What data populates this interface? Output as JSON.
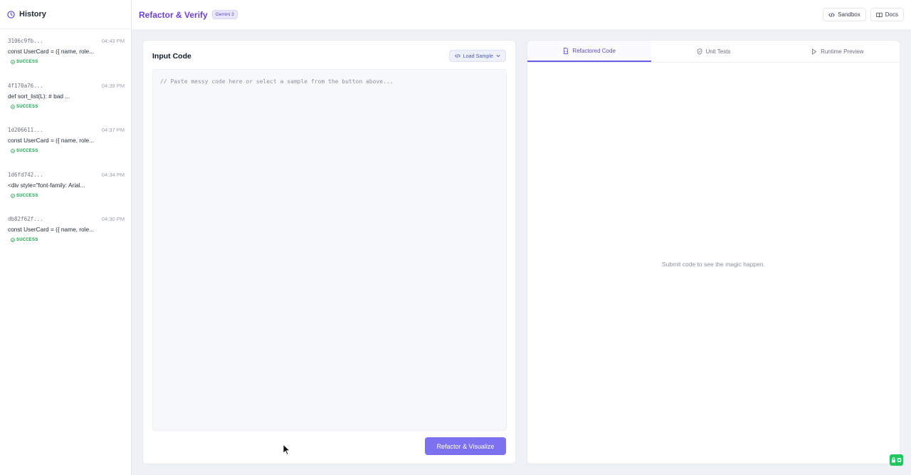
{
  "sidebar": {
    "title": "History",
    "items": [
      {
        "hash": "3106c9fb...",
        "time": "04:43 PM",
        "preview": "const UserCard = ({ name, role...",
        "status": "SUCCESS"
      },
      {
        "hash": "4f170a76...",
        "time": "04:39 PM",
        "preview": "def sort_list(L): # bad ...",
        "status": "SUCCESS"
      },
      {
        "hash": "1d206611...",
        "time": "04:37 PM",
        "preview": "const UserCard = ({ name, role...",
        "status": "SUCCESS"
      },
      {
        "hash": "1d6fd742...",
        "time": "04:34 PM",
        "preview": "<div style=\"font-family: Arial...",
        "status": "SUCCESS"
      },
      {
        "hash": "db82f62f...",
        "time": "04:30 PM",
        "preview": "const UserCard = ({ name, role...",
        "status": "SUCCESS"
      }
    ]
  },
  "header": {
    "title": "Refactor & Verify",
    "badge": "Gemini 3",
    "sandbox_label": "Sandbox",
    "docs_label": "Docs"
  },
  "input": {
    "title": "Input Code",
    "load_sample_label": "Load Sample",
    "value": "",
    "placeholder": "// Paste messy code here or select a sample from the button above...",
    "submit_label": "Refactor & Visualize"
  },
  "output": {
    "tabs": [
      {
        "label": "Refactored Code",
        "icon": "file-code-icon",
        "active": true
      },
      {
        "label": "Unit Tests",
        "icon": "shield-check-icon",
        "active": false
      },
      {
        "label": "Runtime Preview",
        "icon": "play-icon",
        "active": false
      }
    ],
    "empty_message": "Submit code to see the magic happen."
  },
  "colors": {
    "accent": "#6d3fd9",
    "button": "#7c72f0",
    "success": "#16a34a"
  }
}
